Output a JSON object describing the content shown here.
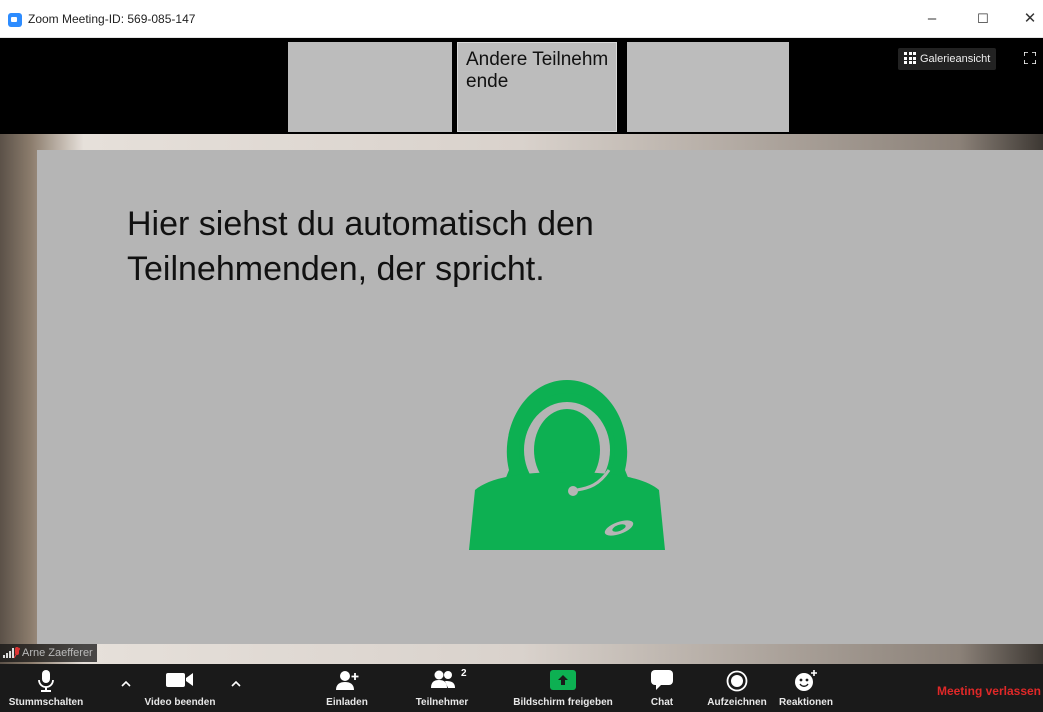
{
  "window": {
    "title": "Zoom Meeting-ID: 569-085-147",
    "minimize": "–",
    "maximize": "☐",
    "close": "✕"
  },
  "strip": {
    "center_label": "Andere Teilnehmende",
    "gallery_label": "Galerieansicht"
  },
  "speaker": {
    "text": "Hier siehst du automatisch den Teilnehmenden, der spricht.",
    "name": "Arne Zaefferer"
  },
  "toolbar": {
    "mute": "Stummschalten",
    "video": "Video beenden",
    "invite": "Einladen",
    "participants": "Teilnehmer",
    "participants_count": "2",
    "share": "Bildschirm freigeben",
    "chat": "Chat",
    "record": "Aufzeichnen",
    "reactions": "Reaktionen",
    "leave": "Meeting verlassen"
  },
  "colors": {
    "accent_green": "#0db052",
    "leave_red": "#e02828",
    "toolbar_bg": "#1a1a1a"
  }
}
